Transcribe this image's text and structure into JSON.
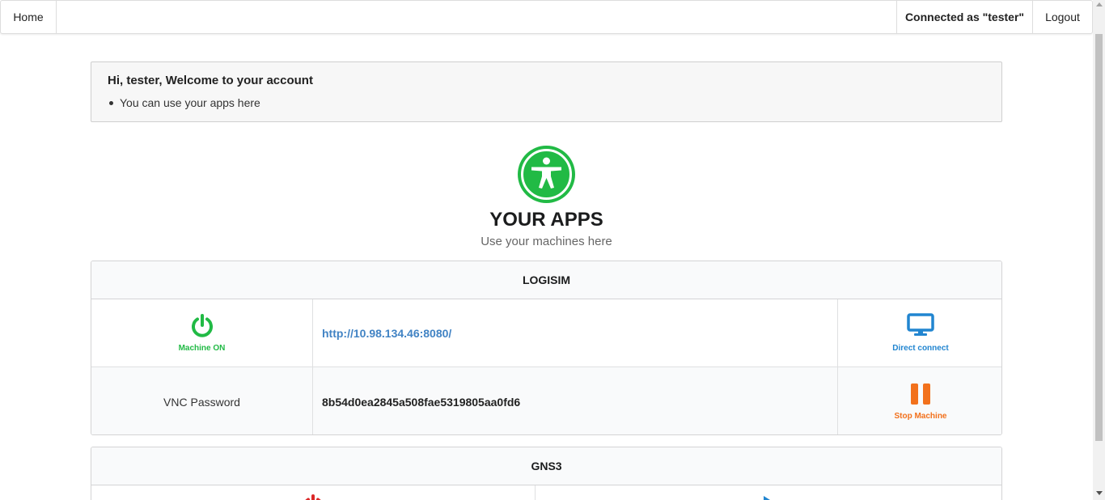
{
  "nav": {
    "home": "Home",
    "connected_as": "Connected as \"tester\"",
    "logout": "Logout"
  },
  "welcome": {
    "title": "Hi, tester, Welcome to your account",
    "bullet": "You can use your apps here"
  },
  "apps_header": {
    "logo_icon": "accessibility-icon",
    "title": "YOUR APPS",
    "subtitle": "Use your machines here"
  },
  "apps": [
    {
      "name": "LOGISIM",
      "status_icon": "power-icon",
      "status_label": "Machine ON",
      "url": "http://10.98.134.46:8080/",
      "connect_icon": "desktop-icon",
      "connect_label": "Direct connect",
      "vnc_label": "VNC Password",
      "vnc_password": "8b54d0ea2845a508fae5319805aa0fd6",
      "stop_icon": "pause-icon",
      "stop_label": "Stop Machine"
    },
    {
      "name": "GNS3",
      "status_icon": "power-icon",
      "action_icon": "play-icon"
    }
  ],
  "colors": {
    "green": "#21ba45",
    "blue": "#2185d0",
    "orange": "#f2711c",
    "red": "#db2828",
    "link": "#4183c4"
  }
}
